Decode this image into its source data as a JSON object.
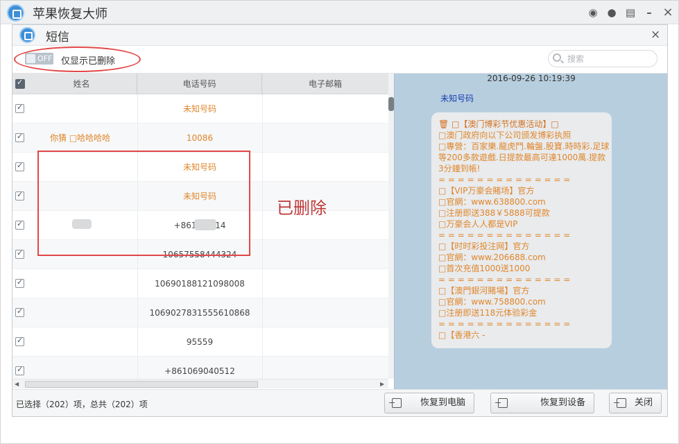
{
  "app": {
    "title": "苹果恢复大师"
  },
  "titlebar_icons": [
    "weibo-icon",
    "chat-icon",
    "list-icon",
    "minimize-icon",
    "close-icon"
  ],
  "dialog": {
    "title": "短信",
    "close_label": "×"
  },
  "toolbar": {
    "toggle_text": "OFF",
    "filter_label": "仅显示已删除",
    "search_placeholder": "搜索"
  },
  "table": {
    "columns": [
      "姓名",
      "电话号码",
      "电子邮箱"
    ],
    "rows": [
      {
        "name": "",
        "phone": "未知号码",
        "email": "",
        "deleted": true
      },
      {
        "name": "你猜 □哈哈哈哈",
        "phone": "10086",
        "email": "",
        "deleted": true
      },
      {
        "name": "",
        "phone": "未知号码",
        "email": "",
        "deleted": true
      },
      {
        "name": "",
        "phone": "未知号码",
        "email": "",
        "deleted": true
      },
      {
        "name": "",
        "phone": "+8613 0414",
        "email": "",
        "deleted": false
      },
      {
        "name": "",
        "phone": "10657558444324",
        "email": "",
        "deleted": false
      },
      {
        "name": "",
        "phone": "10690188121098008",
        "email": "",
        "deleted": false
      },
      {
        "name": "",
        "phone": "1069027831555610868",
        "email": "",
        "deleted": false
      },
      {
        "name": "",
        "phone": "95559",
        "email": "",
        "deleted": false
      },
      {
        "name": "",
        "phone": "+861069040512",
        "email": "",
        "deleted": false
      }
    ]
  },
  "annotation": {
    "deleted_label": "已删除"
  },
  "message": {
    "timestamp": "2016-09-26 10:19:39",
    "sender": "未知号码",
    "lines": [
      "🗑 □【澳门博彩节优惠活动】□",
      "□澳门政府向以下公司颁发博彩执照",
      "□專營：百家樂.龍虎鬥.輪盤.股寶.時時彩.足球",
      "等200多款遊戲.日提款最高可達1000萬.提款",
      "3分鐘到帳!",
      "= = = = = = = = = = = = = =",
      "□【VIP万豪会賭场】官方",
      "□官網：www.638800.com",
      "□注册即送388￥5888可提款",
      "□万豪会人人都是VIP",
      "= = = = = = = = = = = = = =",
      "□【时时彩投注网】官方",
      "□官網：www.206688.com",
      "□首次充值1000送1000",
      "= = = = = = = = = = = = = =",
      "□【澳門銀河賭場】官方",
      "□官網：www.758800.com",
      "□注册即送118元体验彩金",
      "= = = = = = = = = = = = = =",
      "□【香港六 -"
    ]
  },
  "footer": {
    "status": "已选择（202）项，总共（202）项",
    "btn_recover_pc": "恢复到电脑",
    "btn_recover_device": "恢复到设备",
    "btn_close": "关闭"
  },
  "colors": {
    "deleted_text": "#e0862a",
    "annotation_red": "#e24646",
    "message_bg": "#b7cede",
    "sender_blue": "#1a3fb0"
  }
}
